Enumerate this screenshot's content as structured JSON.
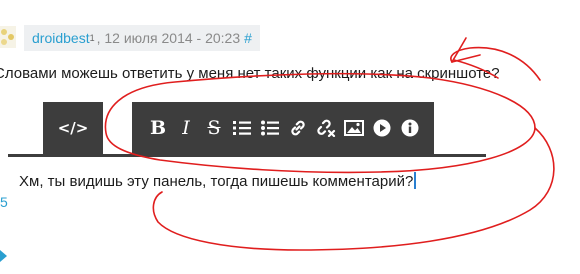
{
  "comment": {
    "author": "droidbest",
    "superscript": "1",
    "date": ", 12 июля 2014 - 20:23",
    "anchor": "#",
    "text": "Словами можешь ответить у меня нет таких функции как на скриншоте?"
  },
  "editor": {
    "code_tab_label": "</>",
    "toolbar": {
      "bold_label": "B",
      "italic_label": "I",
      "strike_label": "S",
      "icons": [
        "numbered-list-icon",
        "bulleted-list-icon",
        "link-icon",
        "unlink-icon",
        "image-icon",
        "video-icon",
        "info-icon"
      ]
    },
    "text": "Хм, ты видишь эту панель, тогда пишешь комментарий?"
  },
  "sidebar": {
    "number": "5"
  },
  "colors": {
    "toolbar_bg": "#3d3d3d",
    "link": "#2a9fd0",
    "annotation": "#e02020",
    "meta_bg": "#eef0f2"
  }
}
